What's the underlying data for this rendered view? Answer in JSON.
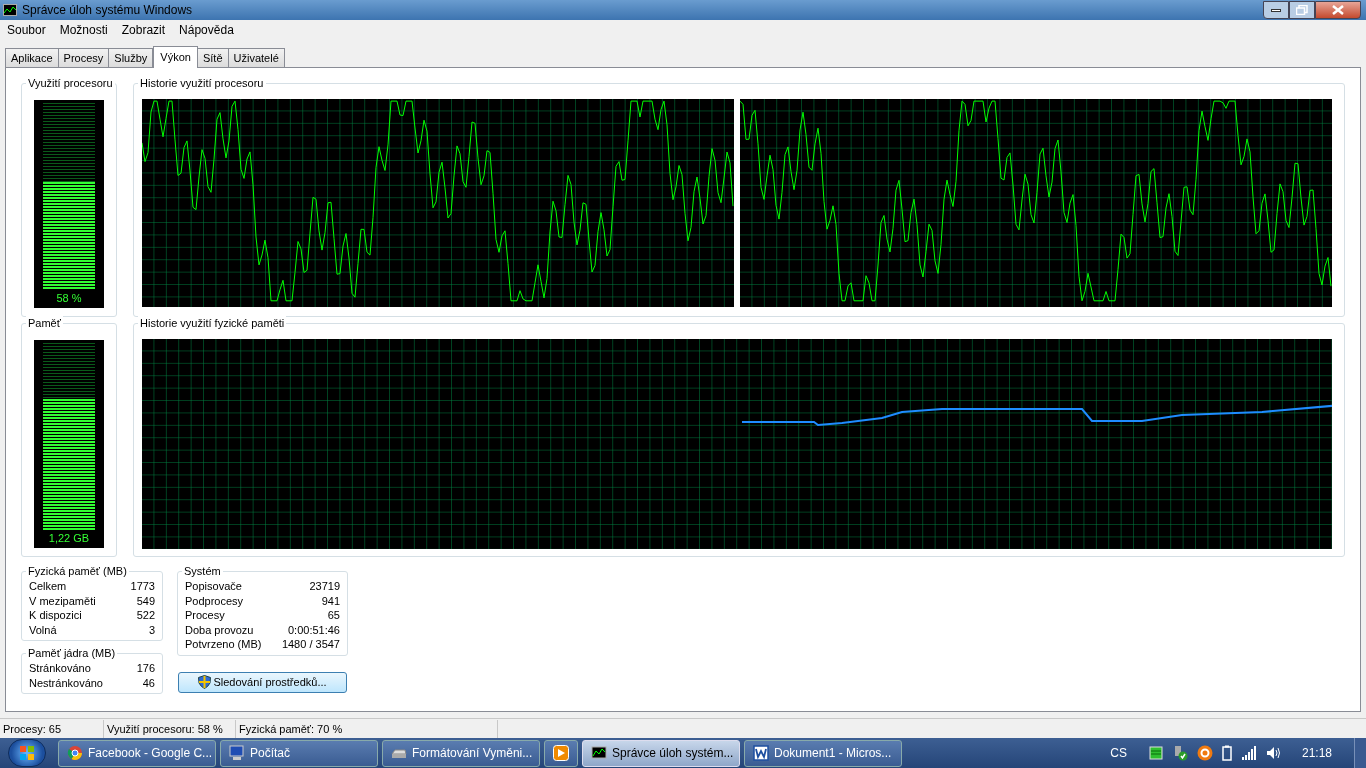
{
  "window": {
    "title": "Správce úloh systému Windows"
  },
  "menu": [
    "Soubor",
    "Možnosti",
    "Zobrazit",
    "Nápověda"
  ],
  "tabs": [
    {
      "label": "Aplikace",
      "selected": false
    },
    {
      "label": "Procesy",
      "selected": false
    },
    {
      "label": "Služby",
      "selected": false
    },
    {
      "label": "Výkon",
      "selected": true
    },
    {
      "label": "Sítě",
      "selected": false
    },
    {
      "label": "Uživatelé",
      "selected": false
    }
  ],
  "cpu_meter": {
    "title": "Využití procesoru",
    "level": 0.58,
    "reading": "58 %"
  },
  "cpu_history": {
    "title": "Historie využití procesoru"
  },
  "memory_meter": {
    "title": "Paměť",
    "level": 0.7,
    "reading": "1,22 GB"
  },
  "memory_history": {
    "title": "Historie využití fyzické paměti"
  },
  "physical_memory": {
    "title": "Fyzická paměť (MB)",
    "rows": [
      {
        "label": "Celkem",
        "value": "1773"
      },
      {
        "label": "V mezipaměti",
        "value": "549"
      },
      {
        "label": "K dispozici",
        "value": "522"
      },
      {
        "label": "Volná",
        "value": "3"
      }
    ]
  },
  "kernel_memory": {
    "title": "Paměť jádra (MB)",
    "rows": [
      {
        "label": "Stránkováno",
        "value": "176"
      },
      {
        "label": "Nestránkováno",
        "value": "46"
      }
    ]
  },
  "system": {
    "title": "Systém",
    "rows": [
      {
        "label": "Popisovače",
        "value": "23719"
      },
      {
        "label": "Podprocesy",
        "value": "941"
      },
      {
        "label": "Procesy",
        "value": "65"
      },
      {
        "label": "Doba provozu",
        "value": "0:00:51:46"
      },
      {
        "label": "Potvrzeno (MB)",
        "value": "1480 / 3547"
      }
    ]
  },
  "resource_monitor_button": "Sledování prostředků...",
  "status_bar": [
    "Procesy: 65",
    "Využití procesoru: 58 %",
    "Fyzická paměť: 70 %"
  ],
  "taskbar": {
    "buttons": [
      {
        "kind": "browser",
        "label": "Facebook - Google C...",
        "selected": false
      },
      {
        "kind": "computer",
        "label": "Počítač",
        "selected": false
      },
      {
        "kind": "drive",
        "label": "Formátování Vyměni...",
        "selected": false
      },
      {
        "kind": "player",
        "selected": false
      },
      {
        "kind": "taskmgr",
        "label": "Správce úloh systém...",
        "selected": true
      },
      {
        "kind": "word",
        "label": "Dokument1 - Micros...",
        "selected": false
      }
    ],
    "language": "CS",
    "clock": "21:18"
  }
}
